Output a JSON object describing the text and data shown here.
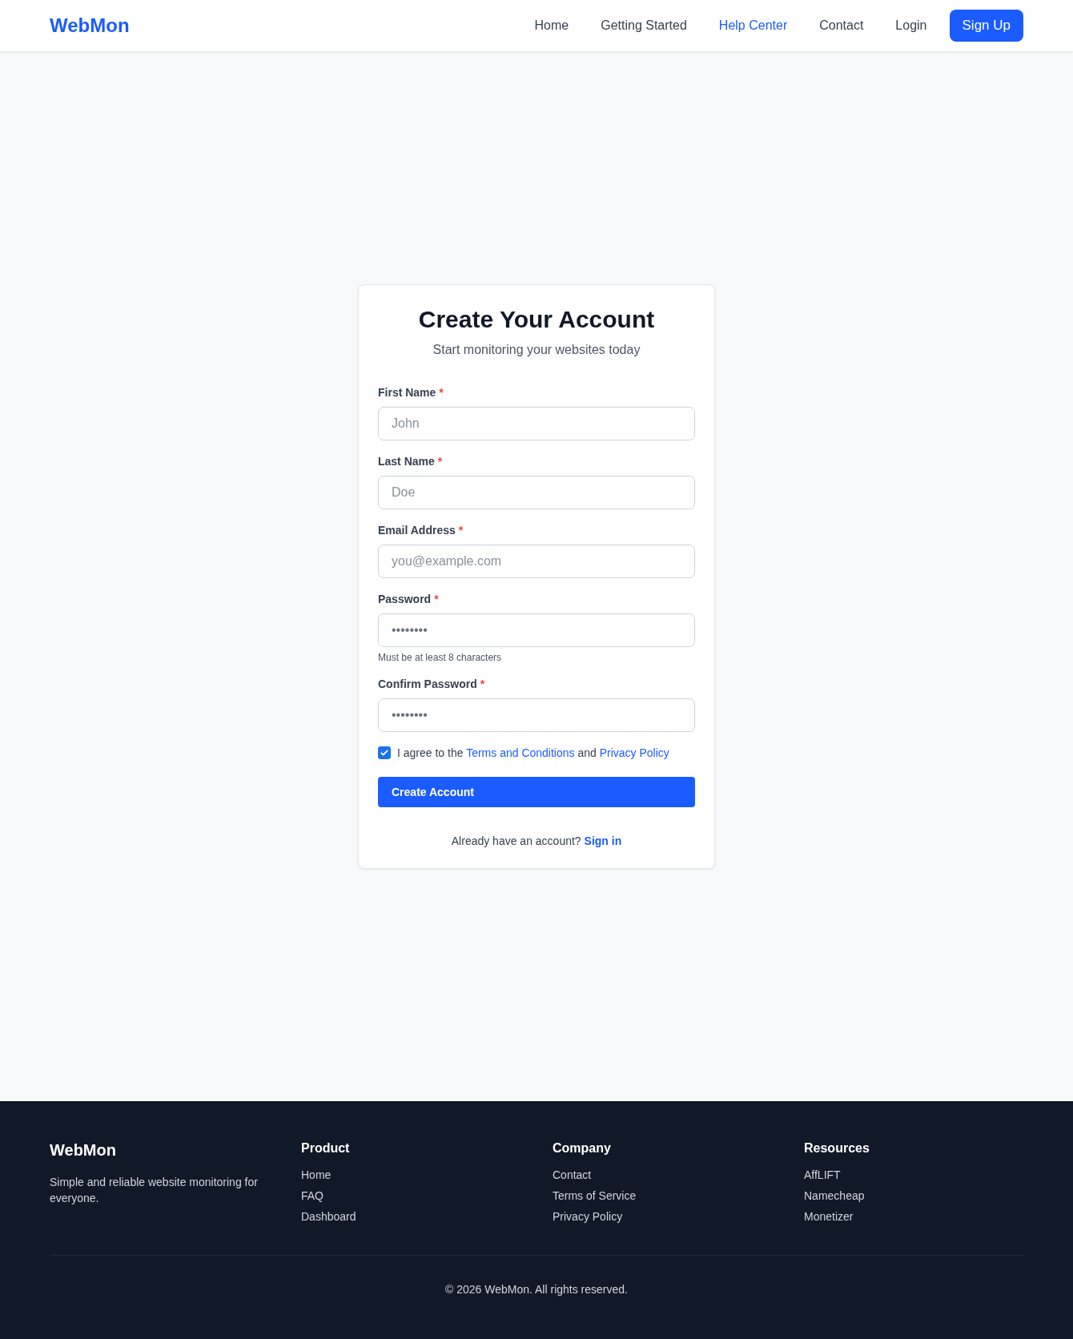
{
  "header": {
    "logo": "WebMon",
    "nav": [
      {
        "label": "Home",
        "selected": false
      },
      {
        "label": "Getting Started",
        "selected": false
      },
      {
        "label": "Help Center",
        "selected": true
      },
      {
        "label": "Contact",
        "selected": false
      },
      {
        "label": "Login",
        "selected": false
      }
    ],
    "cta": "Sign Up"
  },
  "form": {
    "title": "Create Your Account",
    "subtitle": "Start monitoring your websites today",
    "fields": [
      {
        "label": "First Name",
        "required_mark": "*",
        "placeholder": "John"
      },
      {
        "label": "Last Name",
        "required_mark": "*",
        "placeholder": "Doe"
      },
      {
        "label": "Email Address",
        "required_mark": "*",
        "placeholder": "you@example.com"
      },
      {
        "label": "Password",
        "required_mark": "*",
        "value": "••••••••",
        "hint": "Must be at least 8 characters"
      },
      {
        "label": "Confirm Password",
        "required_mark": "*",
        "value": "••••••••"
      }
    ],
    "agreement": {
      "checked": true,
      "text_before": "I agree to the",
      "link_1": "Terms and Conditions",
      "text_middle": "and",
      "link_2": "Privacy Policy"
    },
    "submit": "Create Account",
    "signin_prompt": "Already have an account?",
    "signin_link": "Sign in"
  },
  "footer": {
    "brand": "WebMon",
    "tagline": "Simple and reliable website monitoring for everyone.",
    "columns": [
      {
        "heading": "Product",
        "links": [
          "Home",
          "FAQ",
          "Dashboard"
        ]
      },
      {
        "heading": "Company",
        "links": [
          "Contact",
          "Terms of Service",
          "Privacy Policy"
        ]
      },
      {
        "heading": "Resources",
        "links": [
          "AffLIFT",
          "Namecheap",
          "Monetizer"
        ]
      }
    ],
    "copyright": "© 2026 WebMon. All rights reserved."
  }
}
